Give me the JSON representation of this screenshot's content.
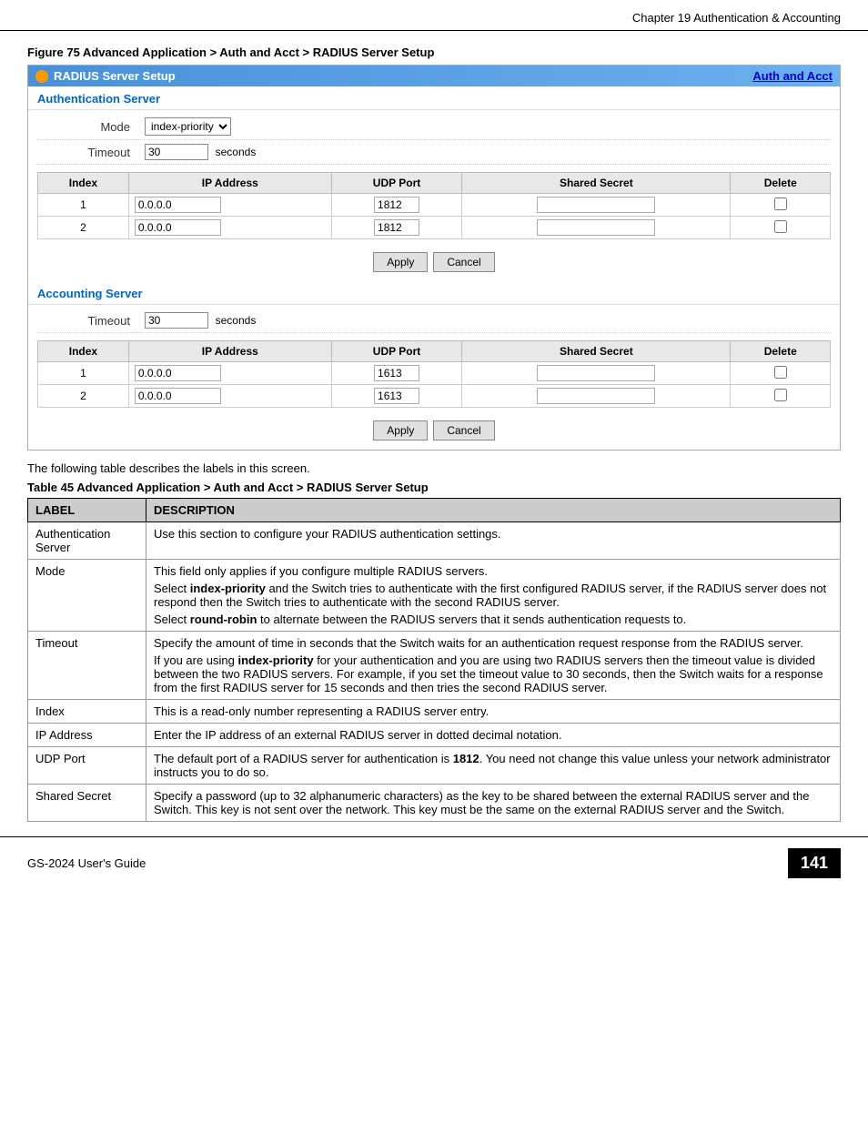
{
  "header": {
    "title": "Chapter 19 Authentication & Accounting"
  },
  "figure": {
    "caption": "Figure 75   Advanced Application > Auth and Acct > RADIUS Server Setup",
    "panel_title": "RADIUS Server Setup",
    "auth_acct_link": "Auth and Acct",
    "auth_section_label": "Authentication Server",
    "auth_mode_label": "Mode",
    "auth_mode_value": "index-priority",
    "auth_timeout_label": "Timeout",
    "auth_timeout_value": "30",
    "auth_seconds": "seconds",
    "auth_table_headers": [
      "Index",
      "IP Address",
      "UDP Port",
      "Shared Secret",
      "Delete"
    ],
    "auth_rows": [
      {
        "index": "1",
        "ip": "0.0.0.0",
        "port": "1812",
        "secret": "",
        "delete": false
      },
      {
        "index": "2",
        "ip": "0.0.0.0",
        "port": "1812",
        "secret": "",
        "delete": false
      }
    ],
    "apply_btn": "Apply",
    "cancel_btn": "Cancel",
    "acct_section_label": "Accounting Server",
    "acct_timeout_label": "Timeout",
    "acct_timeout_value": "30",
    "acct_seconds": "seconds",
    "acct_table_headers": [
      "Index",
      "IP Address",
      "UDP Port",
      "Shared Secret",
      "Delete"
    ],
    "acct_rows": [
      {
        "index": "1",
        "ip": "0.0.0.0",
        "port": "1613",
        "secret": "",
        "delete": false
      },
      {
        "index": "2",
        "ip": "0.0.0.0",
        "port": "1613",
        "secret": "",
        "delete": false
      }
    ],
    "apply_btn2": "Apply",
    "cancel_btn2": "Cancel"
  },
  "following_text": "The following table describes the labels in this screen.",
  "table45": {
    "caption": "Table 45   Advanced Application > Auth and Acct > RADIUS Server Setup",
    "col_label": "LABEL",
    "col_desc": "DESCRIPTION",
    "rows": [
      {
        "label": "Authentication Server",
        "desc": "Use this section to configure your RADIUS authentication settings."
      },
      {
        "label": "Mode",
        "desc": "This field only applies if you configure multiple RADIUS servers.\nSelect index-priority and the Switch tries to authenticate with the first configured RADIUS server, if the RADIUS server does not respond then the Switch tries to authenticate with the second RADIUS server.\nSelect round-robin to alternate between the RADIUS servers that it sends authentication requests to."
      },
      {
        "label": "Timeout",
        "desc": "Specify the amount of time in seconds that the Switch waits for an authentication request response from the RADIUS server.\nIf you are using index-priority for your authentication and you are using two RADIUS servers then the timeout value is divided between the two RADIUS servers. For example, if you set the timeout value to 30 seconds, then the Switch waits for a response from the first RADIUS server for 15 seconds and then tries the second RADIUS server."
      },
      {
        "label": "Index",
        "desc": "This is a read-only number representing a RADIUS server entry."
      },
      {
        "label": "IP Address",
        "desc": "Enter the IP address of an external RADIUS server in dotted decimal notation."
      },
      {
        "label": "UDP Port",
        "desc": "The default port of a RADIUS server for authentication is 1812. You need not change this value unless your network administrator instructs you to do so.",
        "bold_parts": [
          "1812"
        ]
      },
      {
        "label": "Shared Secret",
        "desc": "Specify a password (up to 32 alphanumeric characters) as the key to be shared between the external RADIUS server and the Switch. This key is not sent over the network. This key must be the same on the external RADIUS server and the Switch."
      }
    ]
  },
  "footer": {
    "guide": "GS-2024 User's Guide",
    "page": "141"
  }
}
